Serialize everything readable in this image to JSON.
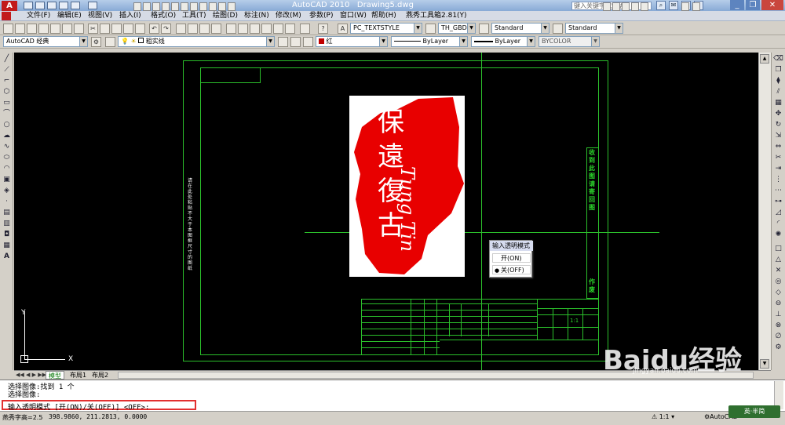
{
  "window": {
    "app_title": "AutoCAD 2010",
    "doc_title": "Drawing5.dwg",
    "search_placeholder": "键入关键字或短语"
  },
  "menu": [
    "文件(F)",
    "编辑(E)",
    "视图(V)",
    "插入(I)",
    "格式(O)",
    "工具(T)",
    "绘图(D)",
    "标注(N)",
    "修改(M)",
    "参数(P)",
    "窗口(W)",
    "帮助(H)",
    "燕秀工具箱2.81(Y)"
  ],
  "toolbar1": {
    "text_style": "PC_TEXTSTYLE",
    "dim_style": "TH_GBDIM",
    "table_style": "Standard",
    "ml_style": "Standard"
  },
  "toolbar2": {
    "workspace": "AutoCAD 经典",
    "layer": "粗实线",
    "color": "红",
    "color_hex": "#c00000",
    "linetype": "ByLayer",
    "lineweight": "ByLayer",
    "plotstyle": "BYCOLOR"
  },
  "drawing": {
    "seal_color": "#e80000",
    "frame_color": "#2bbf2b",
    "side_note": "请在此处粘贴不大于本图框尺寸的图纸",
    "right_col_top": "收到此图请寄回图",
    "right_col_bottom": "作废",
    "seal_text": "Tung Tin",
    "seal_chars": [
      "保",
      "遠",
      "復",
      "古"
    ],
    "table_scale": "1:1"
  },
  "context_menu": {
    "title": "输入透明模式",
    "option_on": "开(ON)",
    "option_off": "关(OFF)"
  },
  "ucs": {
    "y": "Y",
    "x": "X"
  },
  "tabs": [
    "模型",
    "布局1",
    "布局2"
  ],
  "command": {
    "line1": "选择图像:找到 1 个",
    "line2": "选择图像:",
    "prompt": "输入透明模式 [开(ON)/关(OFF)] <OFF>:"
  },
  "status": {
    "text_height": "燕秀字高=2.5",
    "coords": "398.9860, 211.2813, 0.0000",
    "scale": "1:1",
    "workspace": "AutoCAD"
  },
  "watermark": {
    "brand": "Baidu经验",
    "url": "jingyan.baidu.com",
    "badge": "英·半简"
  }
}
